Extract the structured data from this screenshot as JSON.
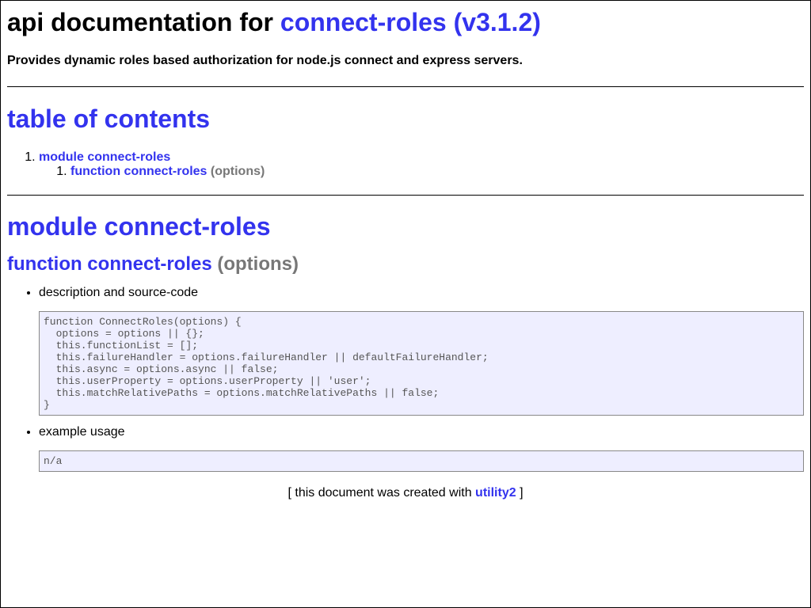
{
  "header": {
    "title_prefix": "api documentation for",
    "title_link": "connect-roles (v3.1.2)",
    "description": "Provides dynamic roles based authorization for node.js connect and express servers."
  },
  "toc": {
    "heading": "table of contents",
    "module_link": "module connect-roles",
    "function_link": "function connect-roles",
    "function_params": "(options)"
  },
  "module": {
    "heading": "module connect-roles",
    "function_name": "function connect-roles",
    "function_params": "(options)",
    "items": [
      {
        "label": "description and source-code",
        "code": "function ConnectRoles(options) {\n  options = options || {};\n  this.functionList = [];\n  this.failureHandler = options.failureHandler || defaultFailureHandler;\n  this.async = options.async || false;\n  this.userProperty = options.userProperty || 'user';\n  this.matchRelativePaths = options.matchRelativePaths || false;\n}"
      },
      {
        "label": "example usage",
        "code": "n/a"
      }
    ]
  },
  "footer": {
    "prefix": "[ this document was created with",
    "link": "utility2",
    "suffix": "]"
  },
  "colors": {
    "link": "#3333ee",
    "muted": "#777777",
    "code_background": "#eeeeff",
    "code_border": "#888888"
  }
}
